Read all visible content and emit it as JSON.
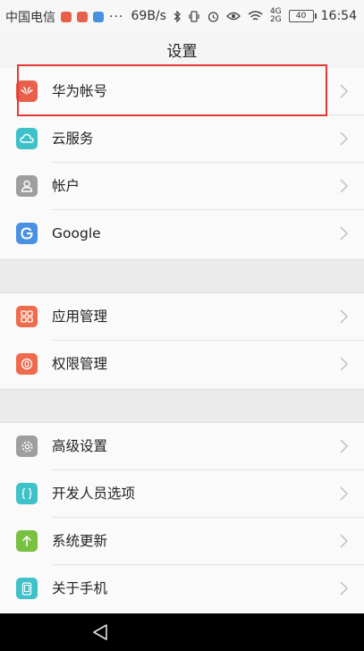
{
  "status_bar": {
    "carrier": "中国电信",
    "speed": "69B/s",
    "signal_top": "4G",
    "signal_bottom": "2G",
    "battery": "40",
    "time": "16:54"
  },
  "header": {
    "title": "设置"
  },
  "groups": [
    {
      "items": [
        {
          "label": "华为帐号",
          "icon": "huawei-logo-icon",
          "color": "#e8604c"
        },
        {
          "label": "云服务",
          "icon": "cloud-icon",
          "color": "#3fc1c9"
        },
        {
          "label": "帐户",
          "icon": "user-icon",
          "color": "#9e9e9e"
        },
        {
          "label": "Google",
          "icon": "google-icon",
          "color": "#4a90e2"
        }
      ]
    },
    {
      "items": [
        {
          "label": "应用管理",
          "icon": "apps-grid-icon",
          "color": "#ef6b4d"
        },
        {
          "label": "权限管理",
          "icon": "permission-icon",
          "color": "#ef6b4d"
        }
      ]
    },
    {
      "items": [
        {
          "label": "高级设置",
          "icon": "gear-icon",
          "color": "#9e9e9e"
        },
        {
          "label": "开发人员选项",
          "icon": "braces-icon",
          "color": "#3fc1c9"
        },
        {
          "label": "系统更新",
          "icon": "arrow-up-icon",
          "color": "#7ac143"
        },
        {
          "label": "关于手机",
          "icon": "phone-icon",
          "color": "#3fc1c9"
        }
      ]
    }
  ],
  "colors": {
    "highlight": "#e53935",
    "background": "#f5f5f5",
    "nav_bar": "#000000"
  }
}
